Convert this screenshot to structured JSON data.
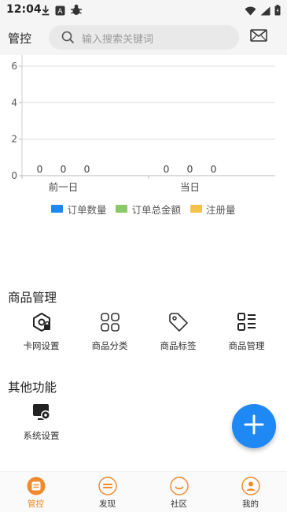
{
  "status_bar": {
    "time": "12:04"
  },
  "header": {
    "title": "管控",
    "search_placeholder": "输入搜索关键词"
  },
  "chart_data": {
    "type": "bar",
    "categories": [
      "前一日",
      "当日"
    ],
    "series": [
      {
        "name": "订单数量",
        "values": [
          0,
          0
        ],
        "color": "#1e88f5"
      },
      {
        "name": "订单总金额",
        "values": [
          0,
          0
        ],
        "color": "#8bc86a"
      },
      {
        "name": "注册量",
        "values": [
          0,
          0
        ],
        "color": "#f6c14a"
      }
    ],
    "y_ticks": [
      "0",
      "2",
      "4",
      "6"
    ],
    "ylim": [
      0,
      6
    ],
    "grid": true,
    "legend": "bottom"
  },
  "goods": {
    "title": "商品管理",
    "items": [
      {
        "label": "卡网设置",
        "icon": "card-settings-icon"
      },
      {
        "label": "商品分类",
        "icon": "category-grid-icon"
      },
      {
        "label": "商品标签",
        "icon": "tag-icon"
      },
      {
        "label": "商品管理",
        "icon": "list-manage-icon"
      }
    ]
  },
  "other": {
    "title": "其他功能",
    "items": [
      {
        "label": "系统设置",
        "icon": "system-settings-icon"
      }
    ]
  },
  "fab": {
    "icon": "plus-icon"
  },
  "nav": {
    "active_color": "#f08a2c",
    "items": [
      {
        "label": "管控",
        "icon": "control-icon",
        "active": true
      },
      {
        "label": "发现",
        "icon": "discover-icon",
        "active": false
      },
      {
        "label": "社区",
        "icon": "community-icon",
        "active": false
      },
      {
        "label": "我的",
        "icon": "profile-icon",
        "active": false
      }
    ]
  }
}
